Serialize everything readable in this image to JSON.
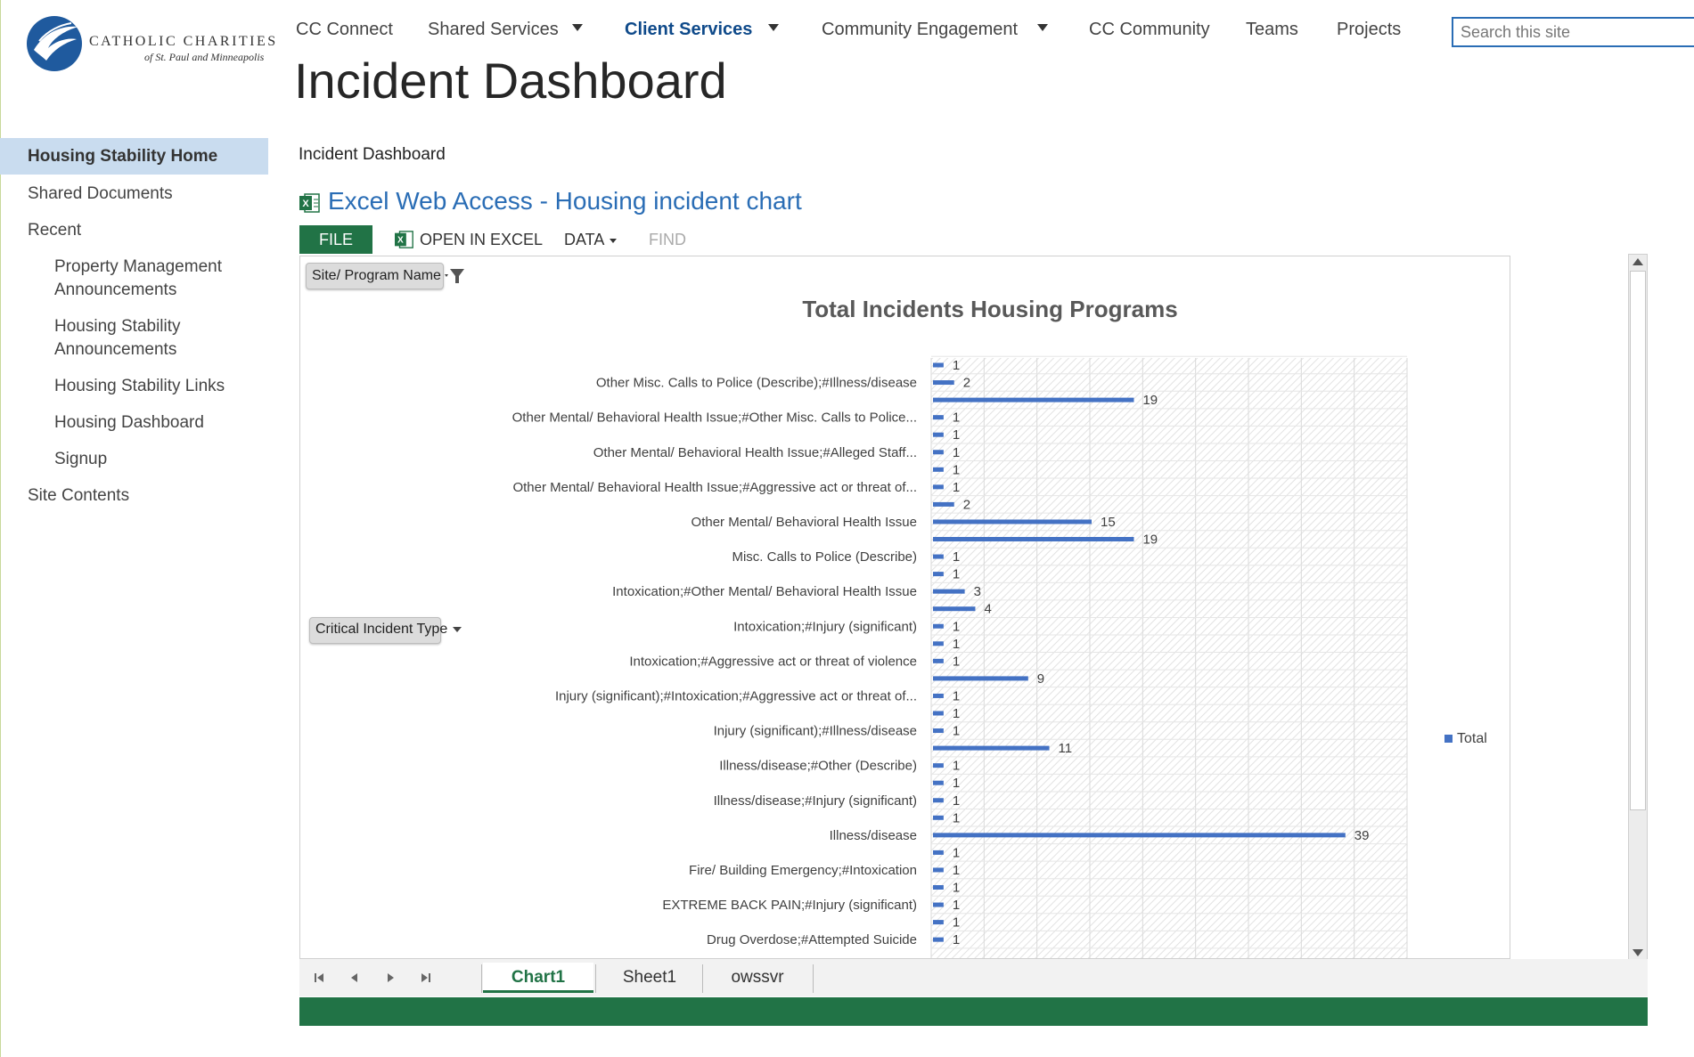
{
  "logo": {
    "title": "CATHOLIC CHARITIES",
    "subtitle": "of St. Paul and Minneapolis"
  },
  "topnav": {
    "items": [
      {
        "label": "CC Connect"
      },
      {
        "label": "Shared Services"
      },
      {
        "label": "Client Services"
      },
      {
        "label": "Community Engagement"
      },
      {
        "label": "CC Community"
      },
      {
        "label": "Teams"
      },
      {
        "label": "Projects"
      }
    ],
    "active": "Client Services",
    "search_placeholder": "Search this site"
  },
  "page": {
    "title": "Incident Dashboard",
    "breadcrumb": "Incident Dashboard"
  },
  "leftnav": {
    "items": [
      {
        "label": "Housing Stability Home"
      },
      {
        "label": "Shared Documents"
      },
      {
        "label": "Recent"
      },
      {
        "label": "Property Management Announcements"
      },
      {
        "label": "Housing Stability Announcements"
      },
      {
        "label": "Housing Stability Links"
      },
      {
        "label": "Housing Dashboard"
      },
      {
        "label": "Signup"
      },
      {
        "label": "Site Contents"
      }
    ]
  },
  "webpart": {
    "title": "Excel Web Access - Housing incident chart",
    "toolbar": {
      "file": "FILE",
      "open": "OPEN IN EXCEL",
      "data": "DATA",
      "find": "FIND"
    },
    "filters": {
      "site": "Site/ Program Name",
      "incident": "Critical Incident Type"
    },
    "sheets": [
      "Chart1",
      "Sheet1",
      "owssvr"
    ],
    "active_sheet": "Chart1"
  },
  "colors": {
    "accent": "#2a6db5",
    "excel_green": "#217346",
    "bar": "#4472c4",
    "nav_active": "#0f4a8a",
    "leftnav_selected": "#c9dcef"
  },
  "chart_data": {
    "type": "bar",
    "orientation": "horizontal",
    "title": "Total Incidents Housing Programs",
    "legend": "right",
    "grid": true,
    "series": [
      {
        "name": "Total",
        "values": [
          1,
          2,
          19,
          1,
          1,
          1,
          1,
          1,
          2,
          15,
          19,
          1,
          1,
          3,
          4,
          1,
          1,
          1,
          9,
          1,
          1,
          1,
          11,
          1,
          1,
          1,
          1,
          39,
          1,
          1,
          1,
          1,
          1,
          1
        ]
      }
    ],
    "categories": [
      "",
      "Other Misc. Calls to Police (Describe);#Illness/disease",
      "",
      "Other Mental/ Behavioral Health Issue;#Other Misc. Calls to Police...",
      "",
      "Other Mental/ Behavioral Health Issue;#Alleged Staff...",
      "",
      "Other Mental/ Behavioral Health Issue;#Aggressive act or threat of...",
      "",
      "Other Mental/ Behavioral Health Issue",
      "",
      "Misc. Calls to Police (Describe)",
      "",
      "Intoxication;#Other Mental/ Behavioral Health Issue",
      "",
      "Intoxication;#Injury (significant)",
      "",
      "Intoxication;#Aggressive act or threat of violence",
      "",
      "Injury (significant);#Intoxication;#Aggressive act or threat of...",
      "",
      "Injury (significant);#Illness/disease",
      "",
      "Illness/disease;#Other (Describe)",
      "",
      "Illness/disease;#Injury (significant)",
      "",
      "Illness/disease",
      "",
      "Fire/ Building Emergency;#Intoxication",
      "",
      "EXTREME BACK PAIN;#Injury (significant)",
      "",
      "Drug Overdose;#Attempted Suicide"
    ],
    "xlim": [
      0,
      45
    ]
  }
}
